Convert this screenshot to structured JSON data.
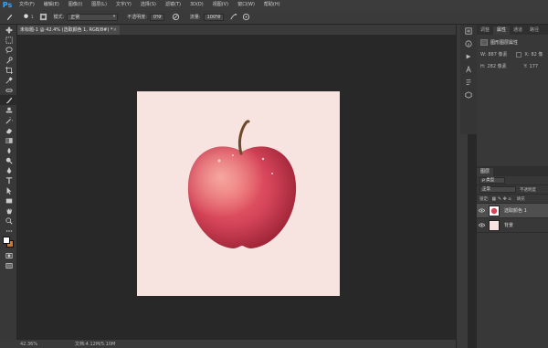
{
  "app": {
    "logo": "Ps"
  },
  "menu": [
    "文件(F)",
    "编辑(E)",
    "图像(I)",
    "图层(L)",
    "文字(Y)",
    "选择(S)",
    "滤镜(T)",
    "3D(D)",
    "视图(V)",
    "窗口(W)",
    "帮助(H)"
  ],
  "options": {
    "brush_size": "1",
    "mode_label": "模式:",
    "mode_value": "正常",
    "opacity_label": "不透明度:",
    "opacity_value": "0%",
    "flow_label": "流量:",
    "flow_value": "100%"
  },
  "document": {
    "tab_title": "未标题-1 @ 42.4% (选取颜色 1, RGB/8#) *",
    "close": "×",
    "background_color": "#f7e4e0"
  },
  "status": {
    "zoom": "42.36%",
    "doc_info": "文档:4.12M/5.10M"
  },
  "properties": {
    "tabs": [
      "调整",
      "属性",
      "通道",
      "路径"
    ],
    "active_tab": "属性",
    "title": "图形图层属性",
    "w_label": "W:",
    "w_value": "887 像素",
    "x_label": "X:",
    "x_value": "82 像",
    "h_label": "H:",
    "h_value": "282 像素",
    "y_label": "Y:",
    "y_value": "177"
  },
  "layers": {
    "tab": "图层",
    "kind": "ρ 类型",
    "blend": "正常",
    "opacity_label": "不透明度",
    "lock_label": "锁定:",
    "fill_label": "填充",
    "items": [
      {
        "name": "选取颜色 1",
        "selected": true
      },
      {
        "name": "背景",
        "selected": false
      }
    ]
  },
  "colors": {
    "ps_blue": "#31a8ff",
    "foreground": "#ffffff",
    "background_swatch": "#c87a35"
  }
}
